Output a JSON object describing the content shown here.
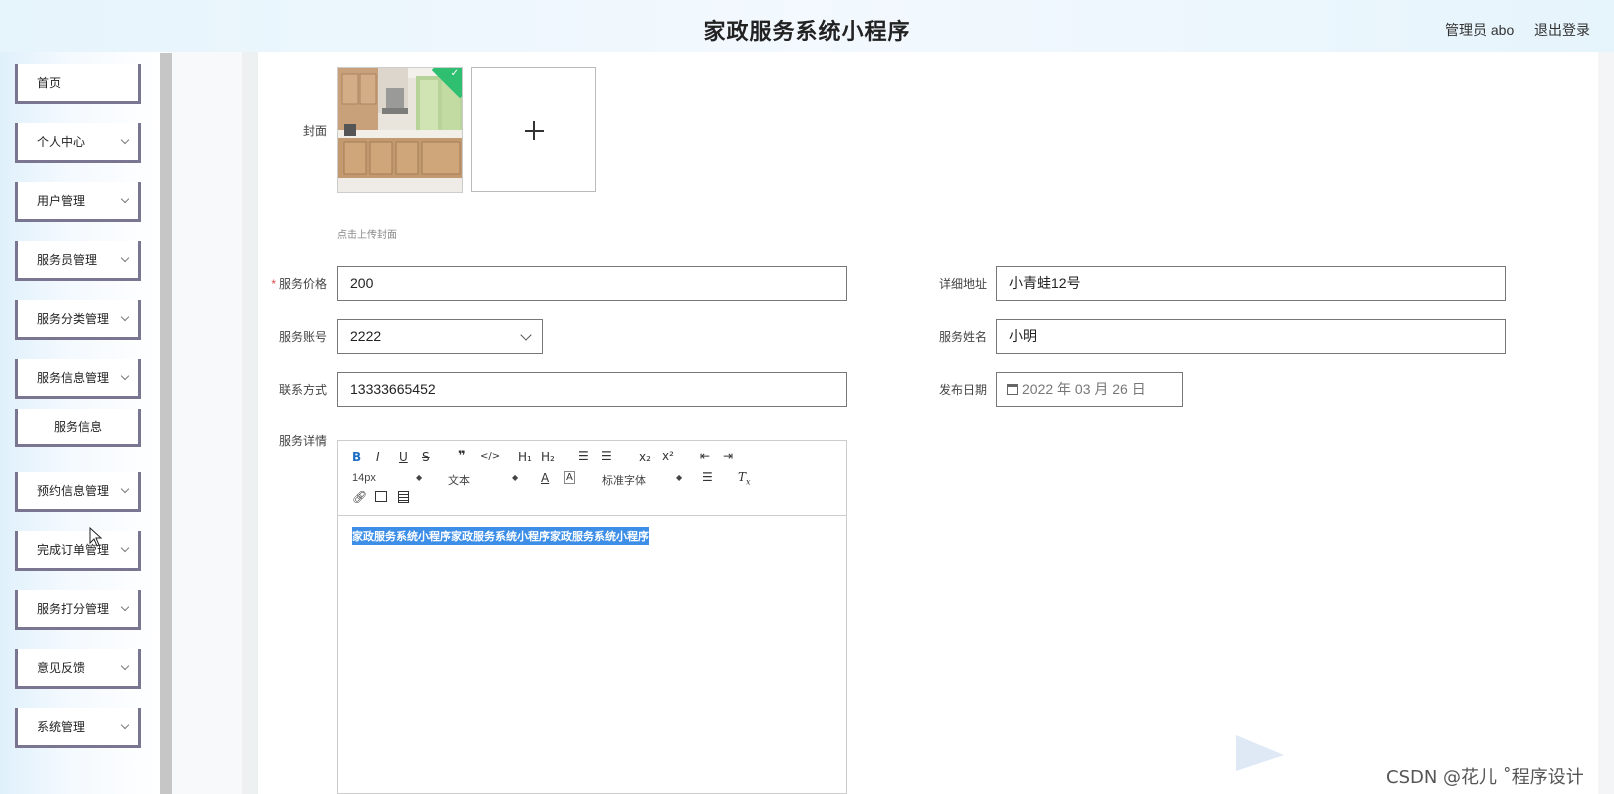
{
  "header": {
    "title": "家政服务系统小程序",
    "admin_label": "管理员 abo",
    "logout_label": "退出登录"
  },
  "sidebar": {
    "items": [
      {
        "label": "首页",
        "has_chevron": false
      },
      {
        "label": "个人中心",
        "has_chevron": true
      },
      {
        "label": "用户管理",
        "has_chevron": true
      },
      {
        "label": "服务员管理",
        "has_chevron": true
      },
      {
        "label": "服务分类管理",
        "has_chevron": true
      },
      {
        "label": "服务信息管理",
        "has_chevron": true
      },
      {
        "label": "服务信息",
        "submenu": true
      },
      {
        "label": "预约信息管理",
        "has_chevron": true
      },
      {
        "label": "完成订单管理",
        "has_chevron": true
      },
      {
        "label": "服务打分管理",
        "has_chevron": true
      },
      {
        "label": "意见反馈",
        "has_chevron": true
      },
      {
        "label": "系统管理",
        "has_chevron": true
      }
    ]
  },
  "form": {
    "cover_label": "封面",
    "cover_hint": "点击上传封面",
    "price_label": "服务价格",
    "price_value": "200",
    "address_label": "详细地址",
    "address_value": "小青蛙12号",
    "account_label": "服务账号",
    "account_value": "2222",
    "name_label": "服务姓名",
    "name_value": "小明",
    "contact_label": "联系方式",
    "contact_value": "13333665452",
    "date_label": "发布日期",
    "date_value": "2022 年 03 月 26 日",
    "detail_label": "服务详情"
  },
  "editor": {
    "font_size": "14px",
    "text_type": "文本",
    "font_family": "标准字体",
    "content": "家政服务系统小程序家政服务系统小程序家政服务系统小程序"
  },
  "watermark": "CSDN @花儿  ˚程序设计",
  "colors": {
    "menu_border": "#7a7591",
    "selection": "#3d8ee6",
    "check_badge": "#2fbf71",
    "required": "#e24a4a"
  }
}
